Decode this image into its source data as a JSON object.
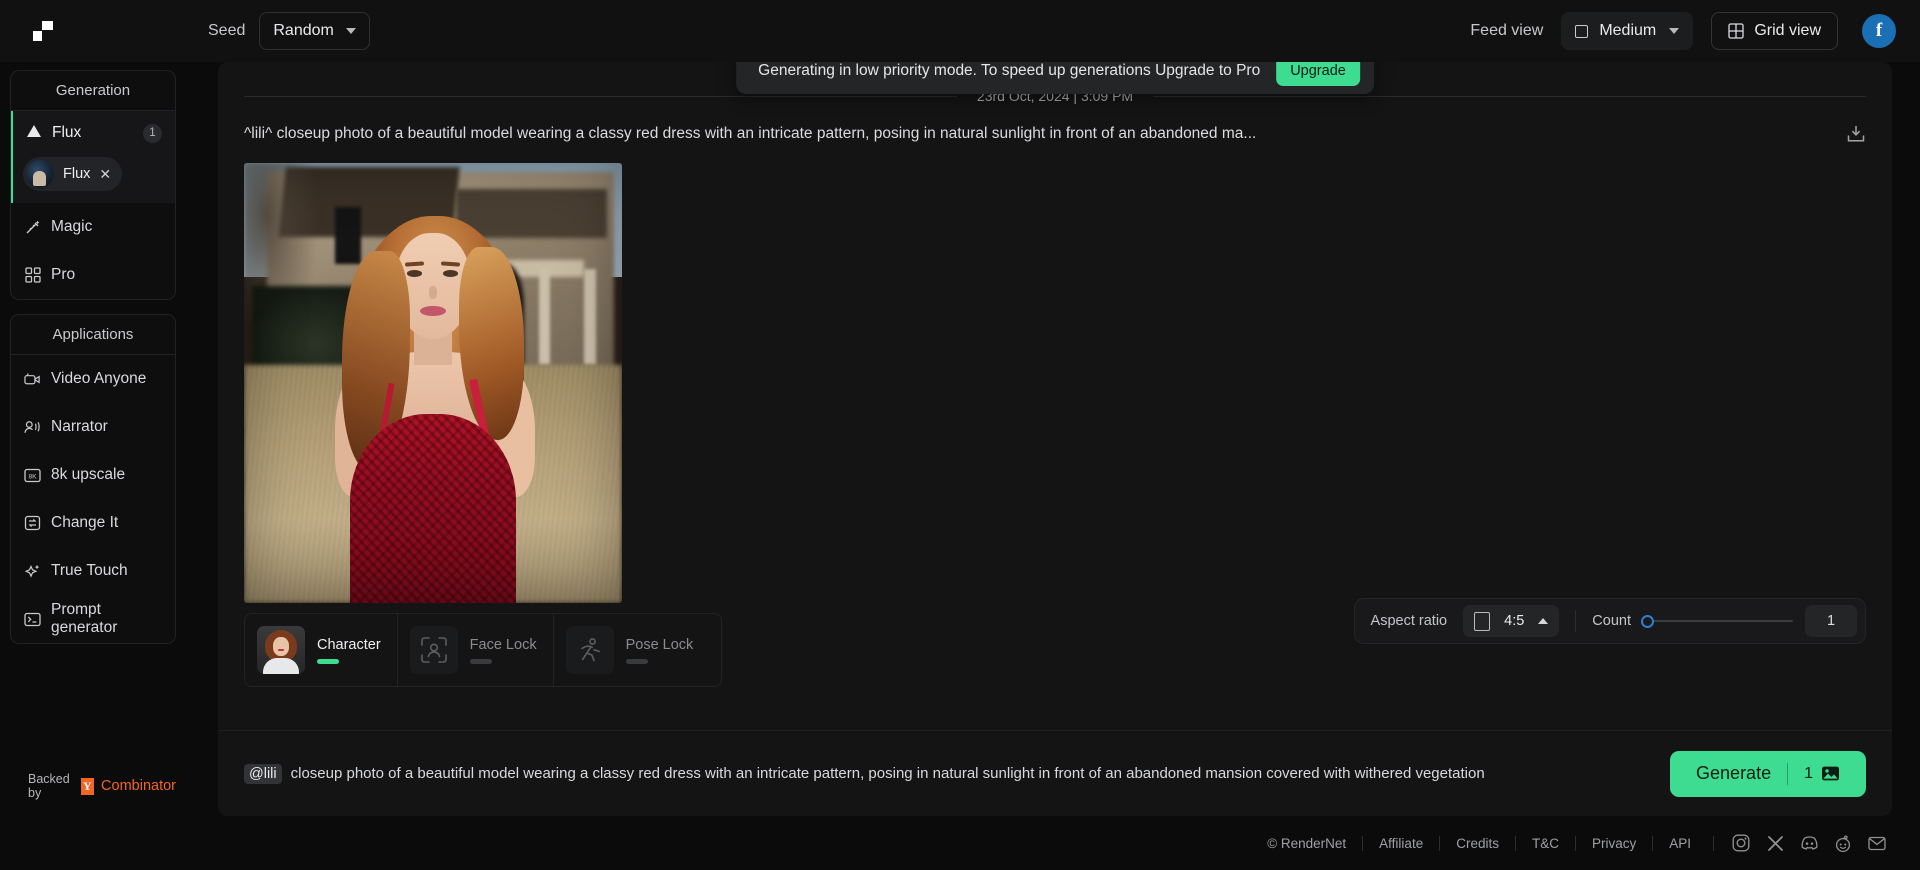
{
  "topbar": {
    "logo_icon": "rendernet-logo-icon",
    "seed_label": "Seed",
    "seed_value": "Random",
    "feed_view_label": "Feed view",
    "size_value": "Medium",
    "size_icon": "square-icon",
    "grid_view_label": "Grid view",
    "grid_view_icon": "grid-icon",
    "avatar_initial": "f"
  },
  "banner": {
    "message": "Generating in low priority mode. To speed up generations Upgrade to Pro",
    "action_label": "Upgrade",
    "accent": "#3ddc91"
  },
  "sidebar": {
    "generation": {
      "title": "Generation",
      "model": {
        "name": "Flux",
        "count": "1",
        "icon": "flux-triangle-icon",
        "accent": "#3ddc91"
      },
      "chip": {
        "label": "Flux",
        "close_icon": "close-icon"
      },
      "items": [
        {
          "label": "Magic",
          "icon": "magic-wand-icon"
        },
        {
          "label": "Pro",
          "icon": "grid-squares-icon"
        }
      ]
    },
    "applications": {
      "title": "Applications",
      "items": [
        {
          "label": "Video Anyone",
          "icon": "video-camera-icon"
        },
        {
          "label": "Narrator",
          "icon": "narrator-voice-icon"
        },
        {
          "label": "8k upscale",
          "icon": "eight-k-icon"
        },
        {
          "label": "Change It",
          "icon": "swap-arrows-icon"
        },
        {
          "label": "True Touch",
          "icon": "sparkle-icon"
        },
        {
          "label": "Prompt generator",
          "icon": "terminal-icon"
        }
      ]
    },
    "footer": {
      "backed_by": "Backed by",
      "yc_mark": "Y",
      "yc_name": "Combinator"
    }
  },
  "feed": {
    "date": "23rd Oct, 2024 | 3:09 PM",
    "prompt_display": "^lili^ closeup photo of a beautiful model wearing a classy red dress with an intricate pattern, posing in natural sunlight in front of an abandoned ma...",
    "download_icon": "download-icon",
    "image_alt": "generated-image-red-dress-model"
  },
  "locks": [
    {
      "name": "Character",
      "icon": "character-thumbnail",
      "active": true,
      "state_color": "#3ddc91"
    },
    {
      "name": "Face Lock",
      "icon": "face-lock-icon",
      "active": false,
      "state_color": "#3a3b3e"
    },
    {
      "name": "Pose Lock",
      "icon": "pose-lock-icon",
      "active": false,
      "state_color": "#3a3b3e"
    }
  ],
  "settings": {
    "aspect_ratio_label": "Aspect ratio",
    "aspect_ratio_value": "4:5",
    "aspect_ratio_icon": "portrait-box-icon",
    "count_label": "Count",
    "count_value": "1",
    "slider_position_pct": 0
  },
  "prompt_bar": {
    "mention": "@lili",
    "text": "closeup photo of a beautiful model wearing a classy red dress with an intricate pattern, posing in natural sunlight in front of an abandoned mansion covered with withered vegetation",
    "generate_label": "Generate",
    "generate_count": "1",
    "generate_icon": "image-icon"
  },
  "footer": {
    "links": [
      "© RenderNet",
      "Affiliate",
      "Credits",
      "T&C",
      "Privacy",
      "API"
    ],
    "socials": [
      "instagram-icon",
      "x-icon",
      "discord-icon",
      "reddit-icon",
      "mail-icon"
    ]
  }
}
